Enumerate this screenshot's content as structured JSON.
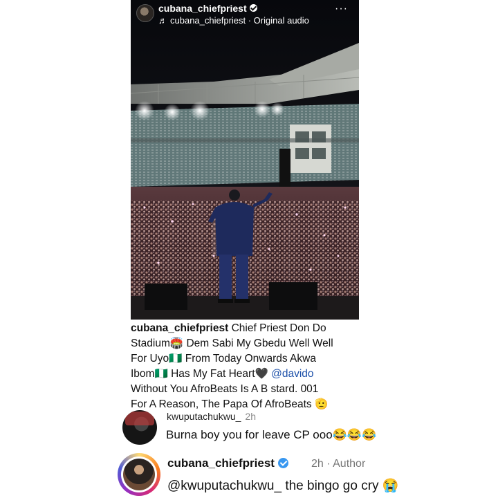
{
  "reel": {
    "username": "cubana_chiefpriest",
    "audio_label": "cubana_chiefpriest · Original audio",
    "note_glyph": "♬",
    "more_glyph": "···"
  },
  "caption": {
    "username": "cubana_chiefpriest",
    "line1": " Chief Priest Don Do",
    "line2": "Stadium🏟️ Dem Sabi My Gbedu Well Well",
    "line3": "For Uyo🇳🇬 From Today Onwards Akwa",
    "line4_a": "Ibom🇳🇬 Has My Fat Heart🖤 ",
    "line4_mention": "@davido",
    "line5": "Without You AfroBeats Is A B stard. 001",
    "line6": "For A Reason, The Papa Of AfroBeats 🫡"
  },
  "comments": [
    {
      "username": "kwuputachukwu_",
      "time": "2h",
      "text": "Burna boy you for leave CP ooo😂😂😂"
    },
    {
      "username": "cubana_chiefpriest",
      "meta": "2h · Author",
      "text": "@kwuputachukwu_ the bingo go cry 😭"
    }
  ],
  "colors": {
    "mention": "#1b4fa8",
    "verified": "#3897f0"
  },
  "icons": {
    "header_verified": "verified-badge-icon",
    "comment_verified": "verified-badge-icon",
    "more": "more-options-icon",
    "audio": "music-note-icon"
  }
}
